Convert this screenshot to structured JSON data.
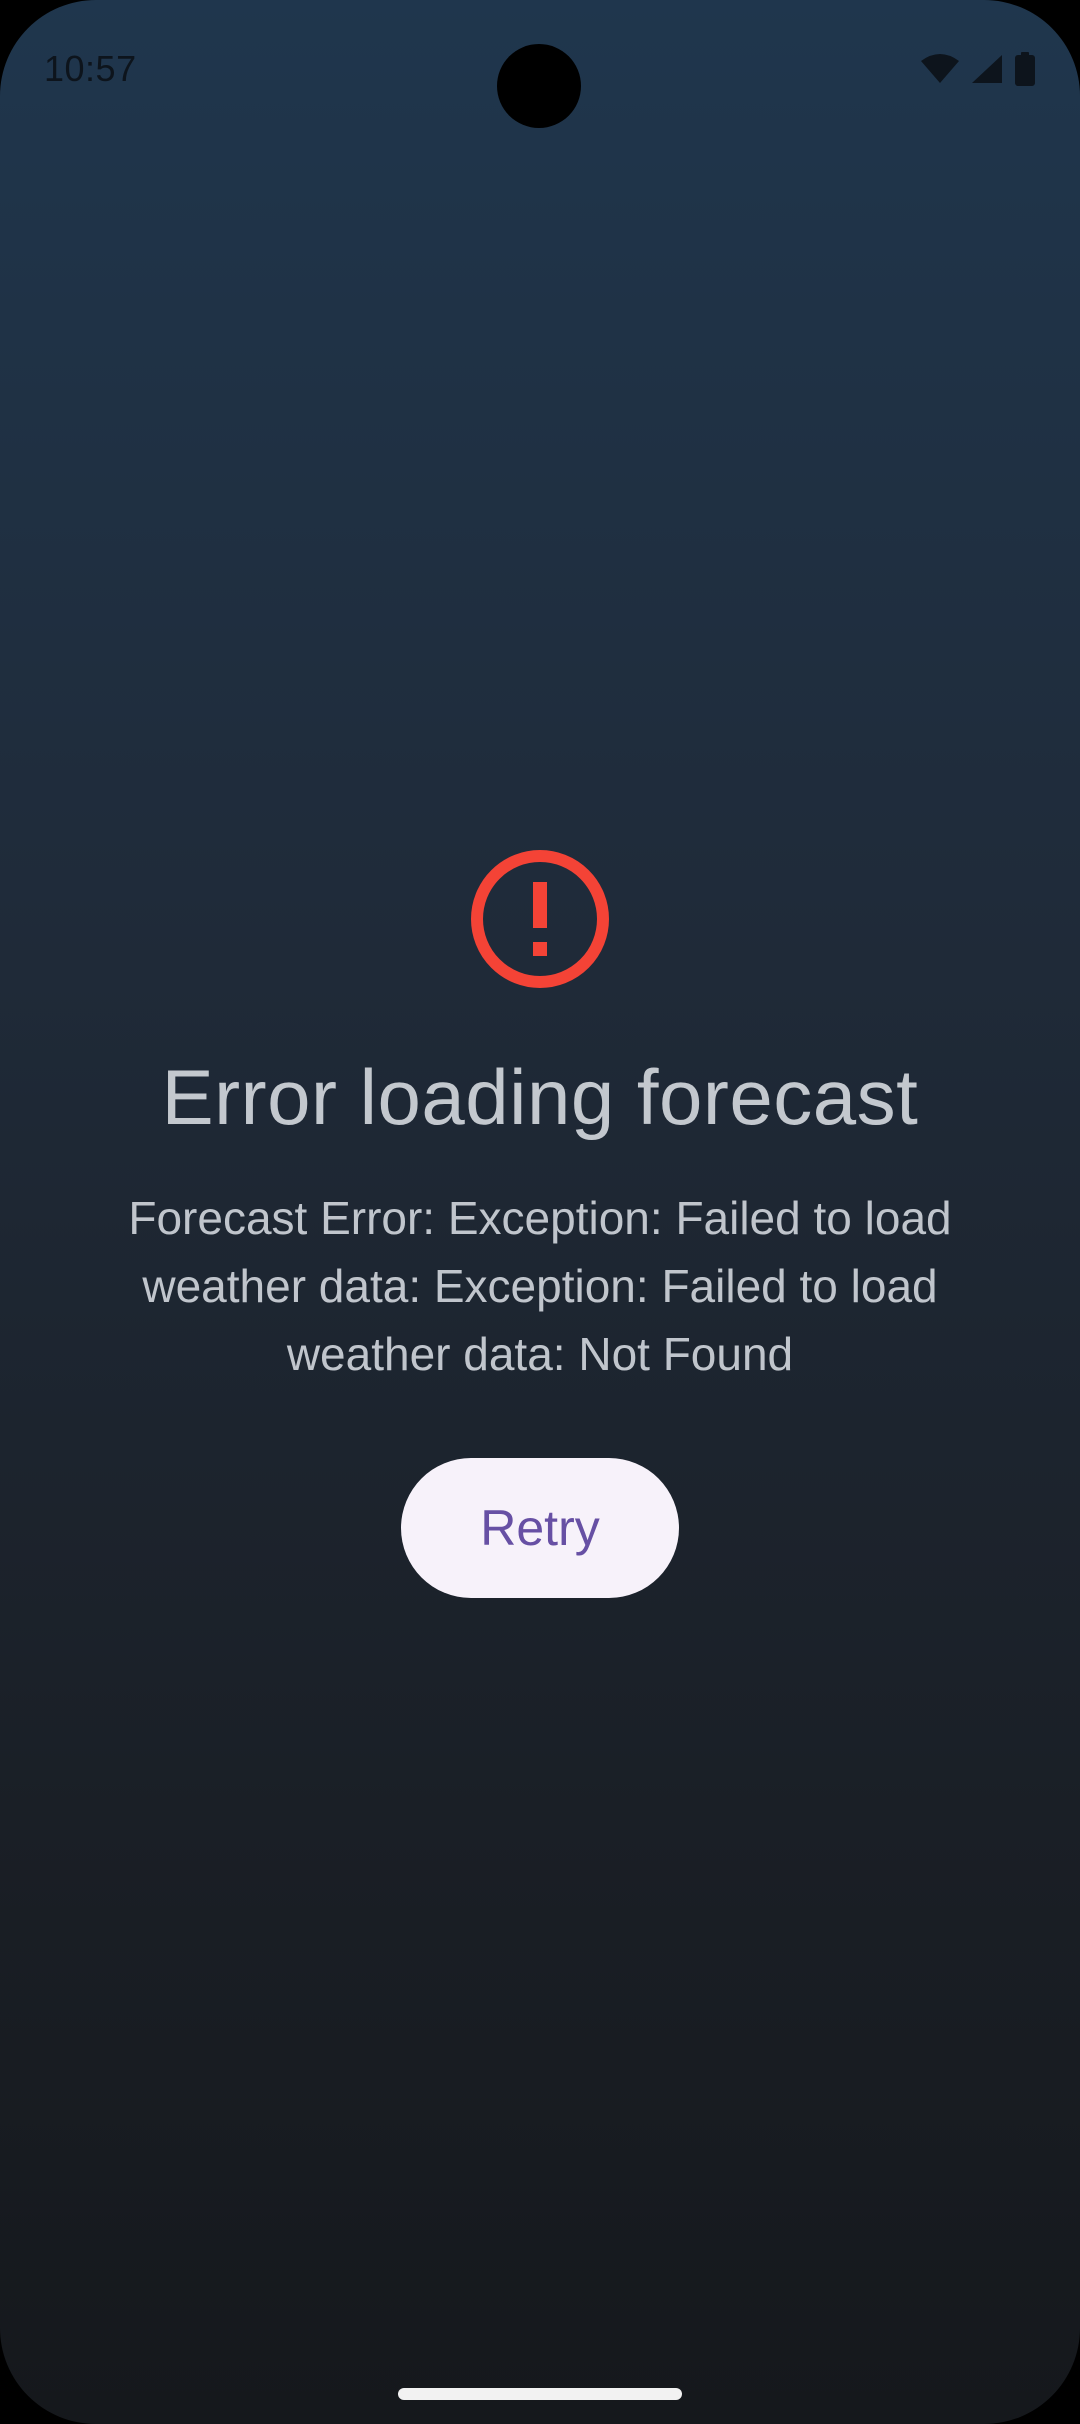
{
  "status_bar": {
    "time": "10:57",
    "icons": [
      "wifi-icon",
      "cellular-signal-icon",
      "battery-icon"
    ]
  },
  "error": {
    "icon": "error-circle-icon",
    "icon_color": "#f44336",
    "title": "Error loading forecast",
    "message": "Forecast Error: Exception: Failed to load weather data: Exception: Failed to load weather data: Not Found"
  },
  "retry_button": {
    "label": "Retry",
    "text_color": "#6750a4",
    "background": "#f7f2fa"
  }
}
